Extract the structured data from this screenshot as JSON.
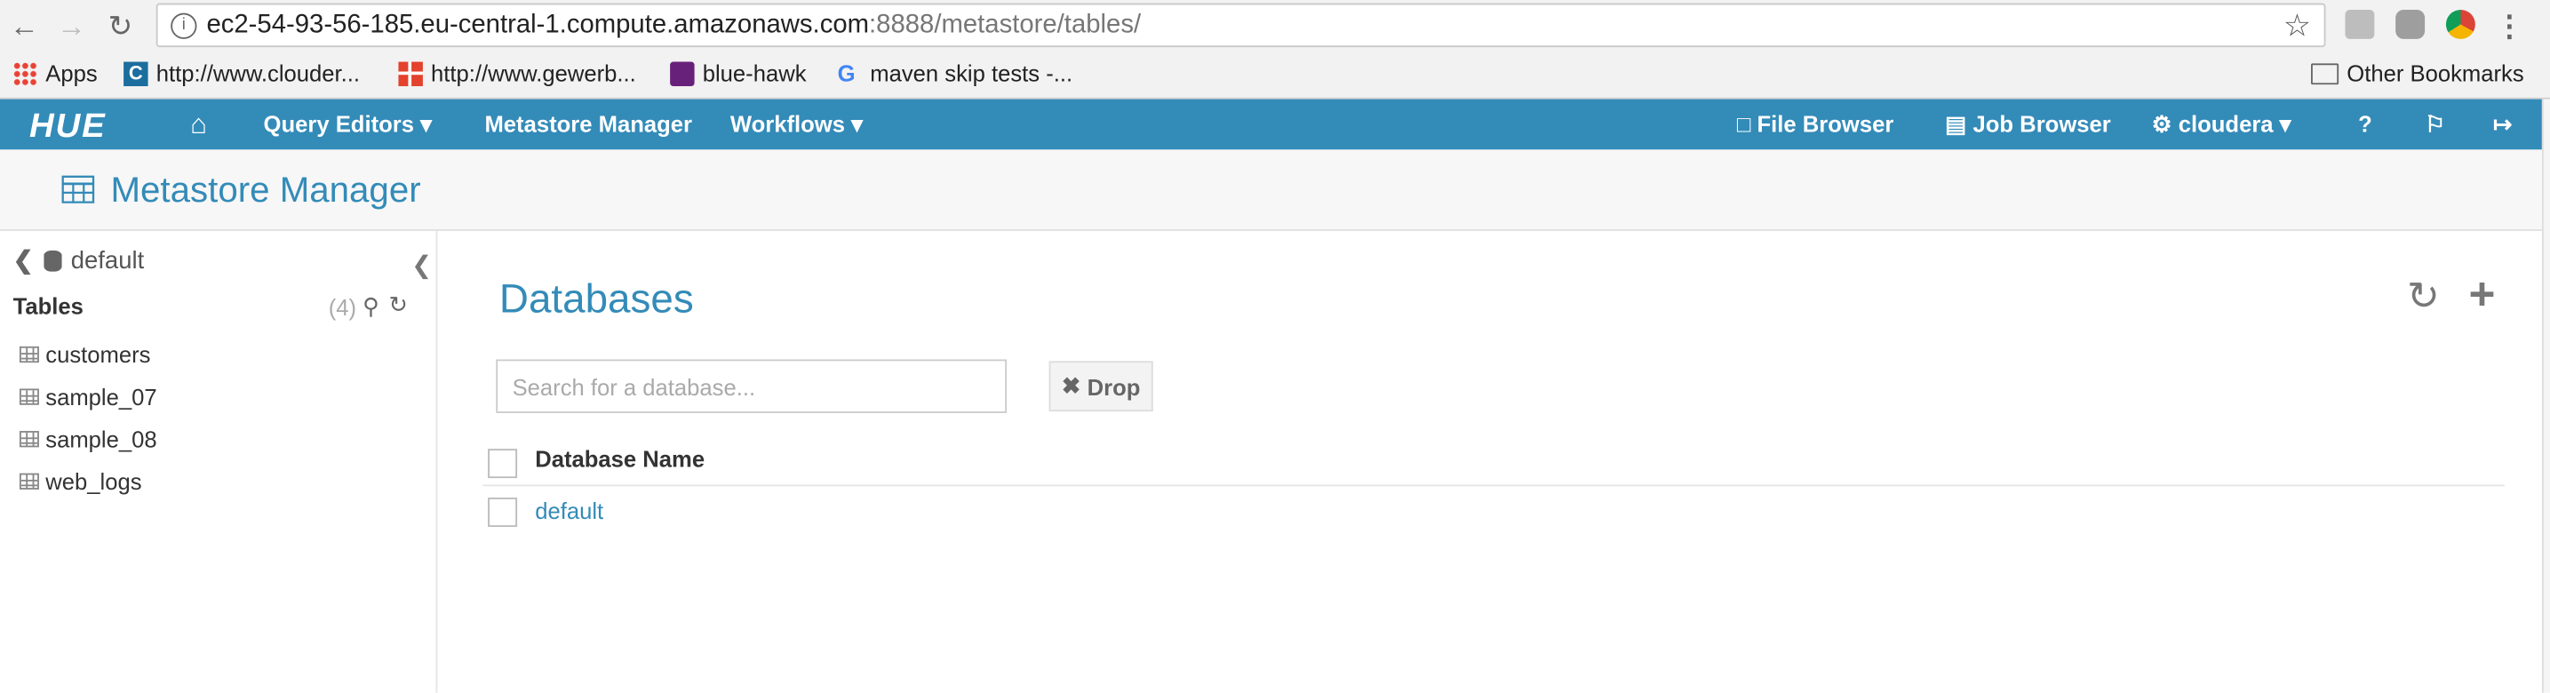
{
  "browser": {
    "url_host": "ec2-54-93-56-185.eu-central-1.compute.amazonaws.com",
    "url_rest": ":8888/metastore/tables/",
    "bookmarks": [
      {
        "label": "Apps",
        "icon": "apps-grid-icon"
      },
      {
        "label": "http://www.clouder...",
        "icon": "cloudera-icon"
      },
      {
        "label": "http://www.gewerb...",
        "icon": "gewerbe-icon"
      },
      {
        "label": "blue-hawk",
        "icon": "visual-studio-icon"
      },
      {
        "label": "maven skip tests -...",
        "icon": "google-icon"
      }
    ],
    "other_bookmarks": "Other Bookmarks"
  },
  "navbar": {
    "logo": "HUE",
    "query_editors": "Query Editors",
    "metastore_manager": "Metastore Manager",
    "workflows": "Workflows",
    "file_browser": "File Browser",
    "job_browser": "Job Browser",
    "user": "cloudera",
    "brand_color": "#338bb8"
  },
  "page": {
    "title": "Metastore Manager"
  },
  "sidebar": {
    "database": "default",
    "tables_label": "Tables",
    "tables_count": "(4)",
    "tables": [
      "customers",
      "sample_07",
      "sample_08",
      "web_logs"
    ]
  },
  "main": {
    "heading": "Databases",
    "search_placeholder": "Search for a database...",
    "drop_label": "Drop",
    "column_header": "Database Name",
    "rows": [
      "default"
    ]
  }
}
